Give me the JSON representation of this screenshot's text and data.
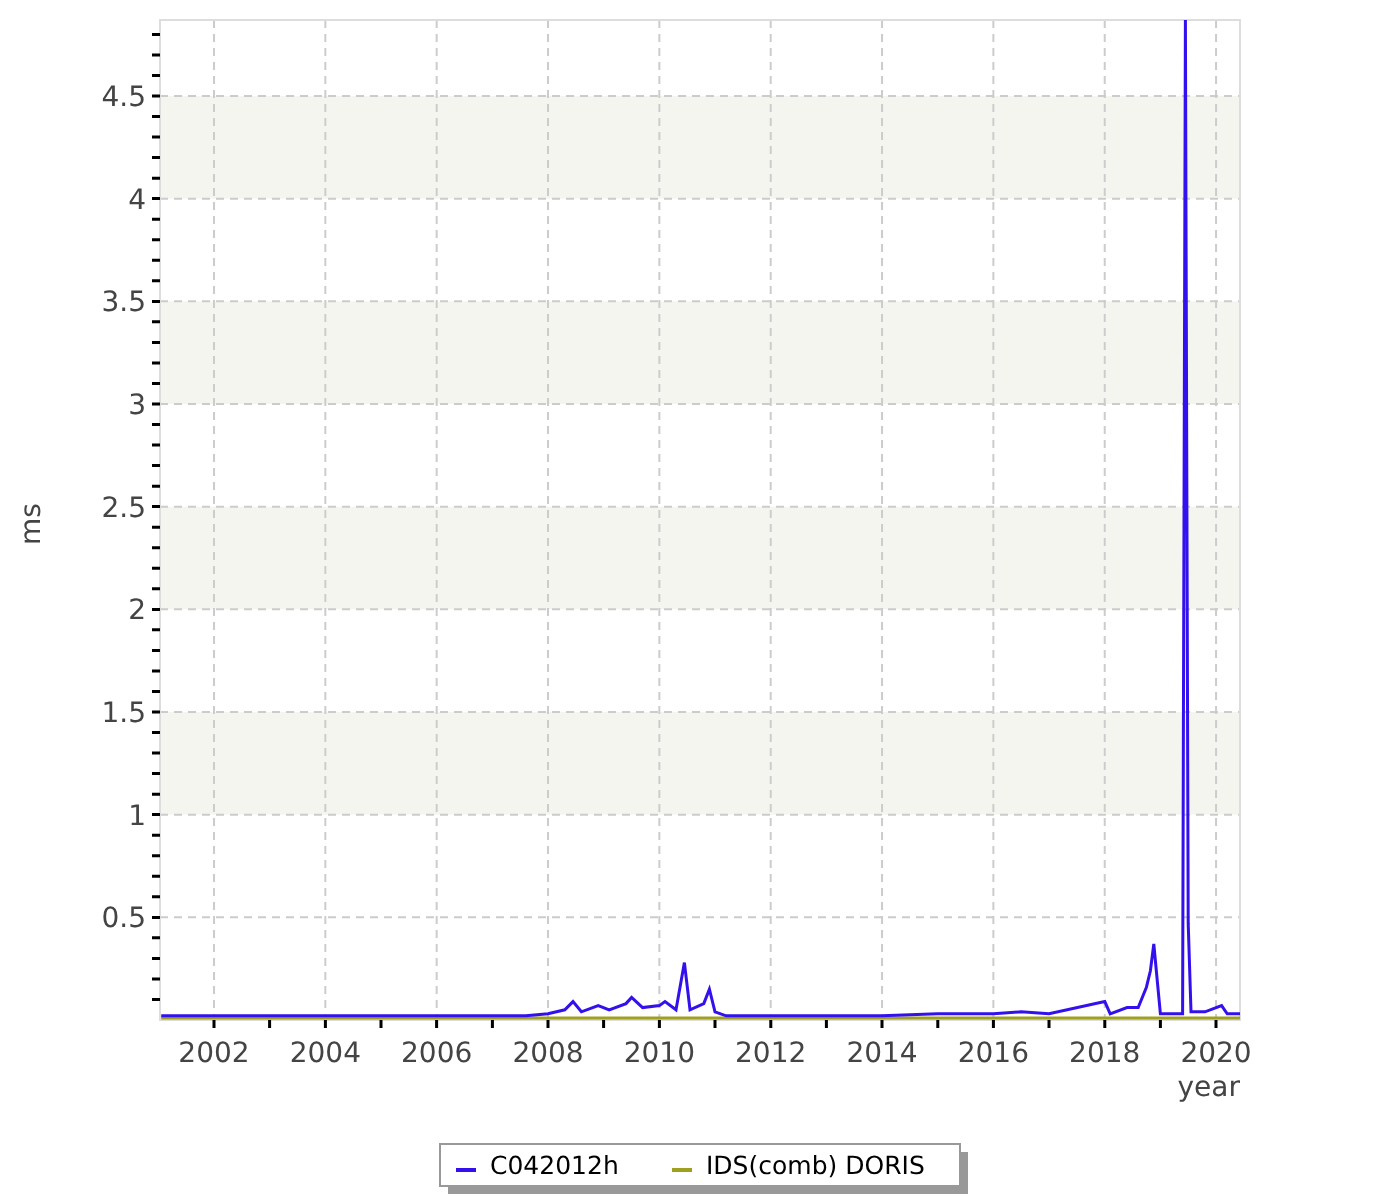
{
  "chart_data": {
    "type": "line",
    "xlabel": "year",
    "ylabel": "ms",
    "grid": true,
    "legend": true,
    "x": [
      2001.05,
      2001.5,
      2003.0,
      2004.7,
      2006.0,
      2007.6,
      2008.0,
      2008.3,
      2008.45,
      2008.6,
      2008.9,
      2009.1,
      2009.4,
      2009.5,
      2009.7,
      2010.0,
      2010.1,
      2010.3,
      2010.45,
      2010.55,
      2010.8,
      2010.9,
      2011.0,
      2011.2,
      2012.0,
      2013.0,
      2014.0,
      2015.0,
      2016.0,
      2016.5,
      2017.0,
      2018.0,
      2018.1,
      2018.4,
      2018.6,
      2018.75,
      2018.82,
      2018.88,
      2019.0,
      2019.4,
      2019.45,
      2019.5,
      2019.55,
      2019.8,
      2020.1,
      2020.2,
      2020.43
    ],
    "series": [
      {
        "name": "C042012h",
        "color": "#3311ee",
        "values": [
          0.02,
          0.02,
          0.02,
          0.02,
          0.02,
          0.02,
          0.03,
          0.05,
          0.09,
          0.04,
          0.07,
          0.05,
          0.08,
          0.11,
          0.06,
          0.07,
          0.09,
          0.05,
          0.28,
          0.05,
          0.08,
          0.15,
          0.04,
          0.02,
          0.02,
          0.02,
          0.02,
          0.03,
          0.03,
          0.04,
          0.03,
          0.09,
          0.03,
          0.06,
          0.06,
          0.16,
          0.24,
          0.37,
          0.03,
          0.03,
          4.87,
          0.47,
          0.04,
          0.04,
          0.07,
          0.03,
          0.03
        ]
      },
      {
        "name": "IDS(comb) DORIS",
        "color": "#a0a020",
        "values": [
          0.01,
          0.01,
          0.01,
          0.01,
          0.01,
          0.01,
          0.01,
          0.01,
          0.01,
          0.01,
          0.01,
          0.01,
          0.01,
          0.01,
          0.01,
          0.01,
          0.01,
          0.01,
          0.01,
          0.01,
          0.01,
          0.01,
          0.01,
          0.01,
          0.01,
          0.01,
          0.01,
          0.01,
          0.01,
          0.01,
          0.01,
          0.01,
          0.01,
          0.01,
          0.01,
          0.01,
          0.01,
          0.01,
          0.01,
          0.01,
          0.01,
          0.01,
          0.01,
          0.01,
          0.01,
          0.01,
          0.01
        ]
      }
    ],
    "xlim": [
      2001.03,
      2020.43
    ],
    "ylim": [
      0,
      4.87
    ],
    "xticks": [
      2002,
      2004,
      2006,
      2008,
      2010,
      2012,
      2014,
      2016,
      2018,
      2020
    ],
    "yticks": [
      0.5,
      1,
      1.5,
      2,
      2.5,
      3,
      3.5,
      4,
      4.5
    ]
  }
}
